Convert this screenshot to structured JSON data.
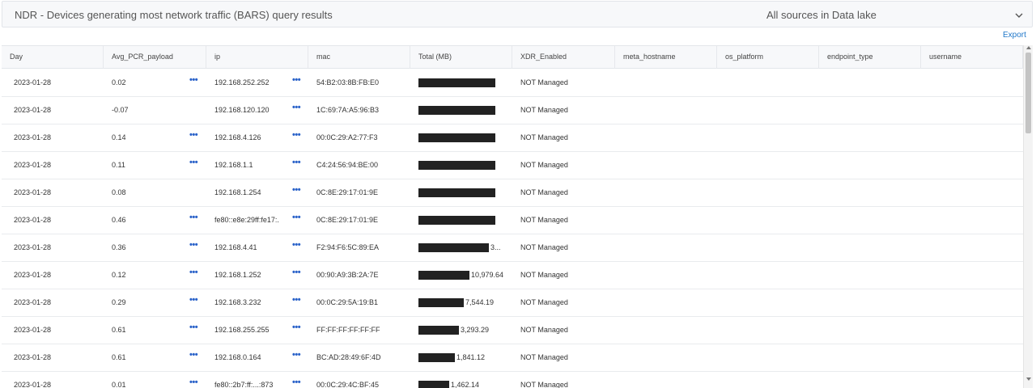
{
  "panel": {
    "title": "NDR - Devices generating most network traffic (BARS) query results",
    "source": "All sources in Data lake",
    "export_label": "Export"
  },
  "table": {
    "columns": [
      "Day",
      "Avg_PCR_payload",
      "ip",
      "mac",
      "Total (MB)",
      "XDR_Enabled",
      "meta_hostname",
      "os_platform",
      "endpoint_type",
      "username"
    ],
    "rows": [
      {
        "day": "2023-01-28",
        "avg_pcr": "0.02",
        "avg_dots": true,
        "ip": "192.168.252.252",
        "ip_dots": true,
        "mac": "54:B2:03:8B:FB:E0",
        "total_label": "",
        "total_bar": 1.0,
        "xdr": "NOT Managed"
      },
      {
        "day": "2023-01-28",
        "avg_pcr": "-0.07",
        "avg_dots": false,
        "ip": "192.168.120.120",
        "ip_dots": true,
        "mac": "1C:69:7A:A5:96:B3",
        "total_label": "",
        "total_bar": 1.0,
        "xdr": "NOT Managed"
      },
      {
        "day": "2023-01-28",
        "avg_pcr": "0.14",
        "avg_dots": true,
        "ip": "192.168.4.126",
        "ip_dots": true,
        "mac": "00:0C:29:A2:77:F3",
        "total_label": "",
        "total_bar": 1.0,
        "xdr": "NOT Managed"
      },
      {
        "day": "2023-01-28",
        "avg_pcr": "0.11",
        "avg_dots": true,
        "ip": "192.168.1.1",
        "ip_dots": true,
        "mac": "C4:24:56:94:BE:00",
        "total_label": "",
        "total_bar": 1.0,
        "xdr": "NOT Managed"
      },
      {
        "day": "2023-01-28",
        "avg_pcr": "0.08",
        "avg_dots": false,
        "ip": "192.168.1.254",
        "ip_dots": true,
        "mac": "0C:8E:29:17:01:9E",
        "total_label": "",
        "total_bar": 1.0,
        "xdr": "NOT Managed"
      },
      {
        "day": "2023-01-28",
        "avg_pcr": "0.46",
        "avg_dots": true,
        "ip": "fe80::e8e:29ff:fe17:...",
        "ip_dots": true,
        "mac": "0C:8E:29:17:01:9E",
        "total_label": "",
        "total_bar": 1.0,
        "xdr": "NOT Managed"
      },
      {
        "day": "2023-01-28",
        "avg_pcr": "0.36",
        "avg_dots": true,
        "ip": "192.168.4.41",
        "ip_dots": true,
        "mac": "F2:94:F6:5C:89:EA",
        "total_label": "3...",
        "total_bar": 0.92,
        "xdr": "NOT Managed"
      },
      {
        "day": "2023-01-28",
        "avg_pcr": "0.12",
        "avg_dots": true,
        "ip": "192.168.1.252",
        "ip_dots": true,
        "mac": "00:90:A9:3B:2A:7E",
        "total_label": "10,979.64",
        "total_bar": 0.66,
        "xdr": "NOT Managed"
      },
      {
        "day": "2023-01-28",
        "avg_pcr": "0.29",
        "avg_dots": true,
        "ip": "192.168.3.232",
        "ip_dots": true,
        "mac": "00:0C:29:5A:19:B1",
        "total_label": "7,544.19",
        "total_bar": 0.59,
        "xdr": "NOT Managed"
      },
      {
        "day": "2023-01-28",
        "avg_pcr": "0.61",
        "avg_dots": true,
        "ip": "192.168.255.255",
        "ip_dots": true,
        "mac": "FF:FF:FF:FF:FF:FF",
        "total_label": "3,293.29",
        "total_bar": 0.53,
        "xdr": "NOT Managed"
      },
      {
        "day": "2023-01-28",
        "avg_pcr": "0.61",
        "avg_dots": true,
        "ip": "192.168.0.164",
        "ip_dots": true,
        "mac": "BC:AD:28:49:6F:4D",
        "total_label": "1,841.12",
        "total_bar": 0.47,
        "xdr": "NOT Managed"
      },
      {
        "day": "2023-01-28",
        "avg_pcr": "0.01",
        "avg_dots": true,
        "ip": "fe80::2b7:ff:...:873",
        "ip_dots": true,
        "mac": "00:0C:29:4C:BF:45",
        "total_label": "1,462.14",
        "total_bar": 0.4,
        "xdr": "NOT Managed"
      }
    ]
  },
  "colors": {
    "bar": "#222222",
    "link": "#1f77c9",
    "header_bg": "#f7f8fa"
  }
}
